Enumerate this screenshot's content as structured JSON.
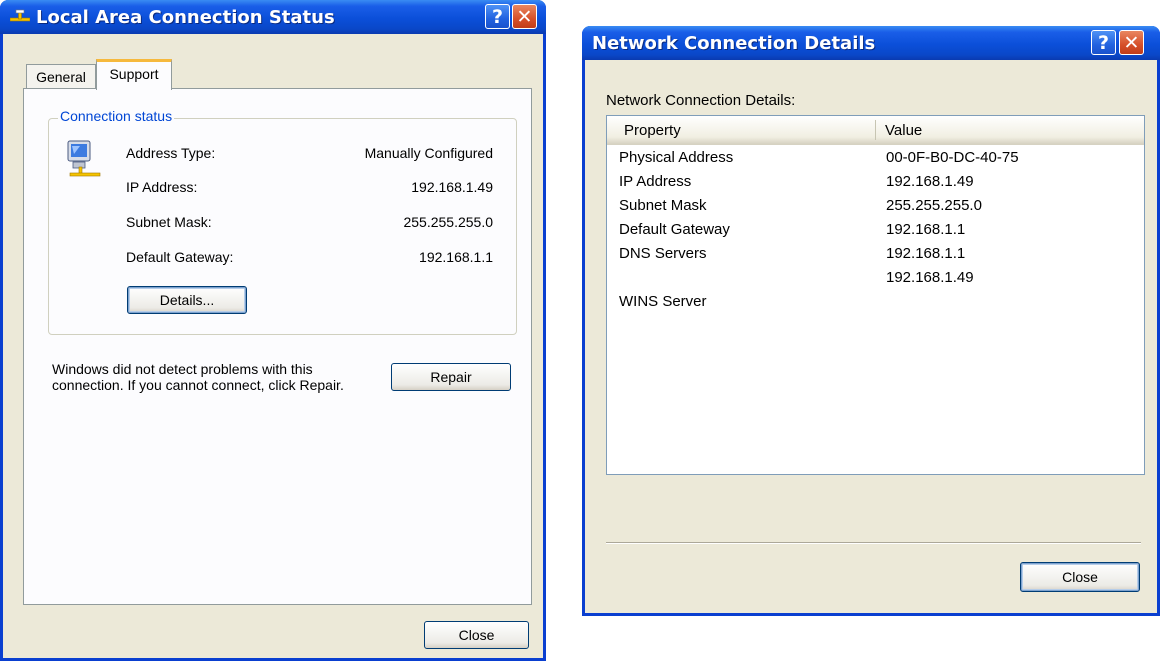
{
  "left_dialog": {
    "title": "Local Area Connection Status",
    "tabs": [
      {
        "label": "General",
        "active": false
      },
      {
        "label": "Support",
        "active": true
      }
    ],
    "group_title": "Connection status",
    "fields": [
      {
        "label": "Address Type:",
        "value": "Manually Configured"
      },
      {
        "label": "IP Address:",
        "value": "192.168.1.49"
      },
      {
        "label": "Subnet Mask:",
        "value": "255.255.255.0"
      },
      {
        "label": "Default Gateway:",
        "value": "192.168.1.1"
      }
    ],
    "details_button": "Details...",
    "message": "Windows did not detect problems with this connection. If you cannot connect, click Repair.",
    "repair_button": "Repair",
    "close_button": "Close"
  },
  "right_dialog": {
    "title": "Network Connection Details",
    "heading": "Network Connection Details:",
    "columns": [
      "Property",
      "Value"
    ],
    "rows": [
      {
        "property": "Physical Address",
        "value": "00-0F-B0-DC-40-75"
      },
      {
        "property": "IP Address",
        "value": "192.168.1.49"
      },
      {
        "property": "Subnet Mask",
        "value": "255.255.255.0"
      },
      {
        "property": "Default Gateway",
        "value": "192.168.1.1"
      },
      {
        "property": "DNS Servers",
        "value": "192.168.1.1"
      },
      {
        "property": "",
        "value": "192.168.1.49"
      },
      {
        "property": "WINS Server",
        "value": ""
      }
    ],
    "close_button": "Close"
  },
  "titlebar_buttons": {
    "help": "?",
    "close": "✕"
  },
  "colors": {
    "titlebar": "#0b4fd9",
    "client": "#ece9d8",
    "accent_text": "#0046d5"
  }
}
